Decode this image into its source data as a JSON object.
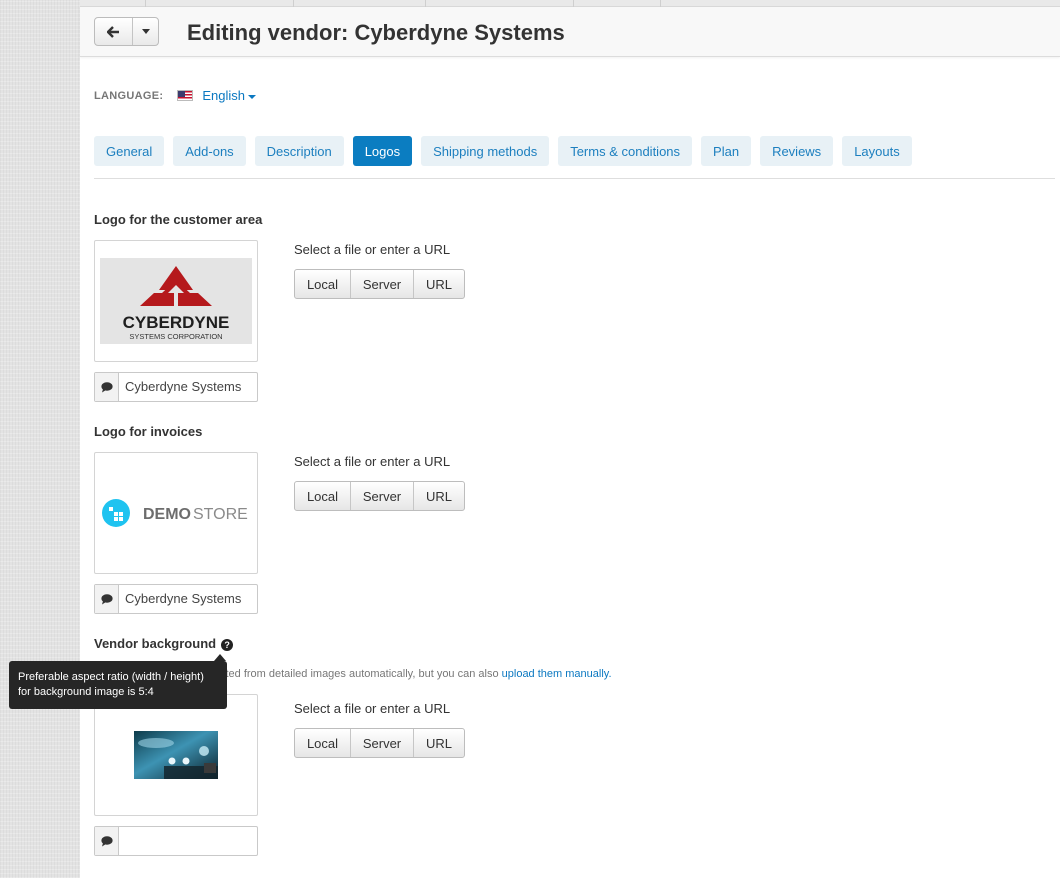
{
  "header": {
    "title": "Editing vendor: Cyberdyne Systems"
  },
  "language": {
    "label": "LANGUAGE:",
    "value": "English"
  },
  "tabs": [
    {
      "label": "General",
      "active": false
    },
    {
      "label": "Add-ons",
      "active": false
    },
    {
      "label": "Description",
      "active": false
    },
    {
      "label": "Logos",
      "active": true
    },
    {
      "label": "Shipping methods",
      "active": false
    },
    {
      "label": "Terms & conditions",
      "active": false
    },
    {
      "label": "Plan",
      "active": false
    },
    {
      "label": "Reviews",
      "active": false
    },
    {
      "label": "Layouts",
      "active": false
    }
  ],
  "sections": {
    "customer_logo": {
      "title": "Logo for the customer area",
      "select_label": "Select a file or enter a URL",
      "logo_text": "CYBERDYNE",
      "logo_subtext": "SYSTEMS CORPORATION",
      "alt_text": "Cyberdyne Systems"
    },
    "invoice_logo": {
      "title": "Logo for invoices",
      "select_label": "Select a file or enter a URL",
      "logo_text_bold": "DEMO",
      "logo_text_light": "STORE",
      "alt_text": "Cyberdyne Systems"
    },
    "background": {
      "title": "Vendor background",
      "hint_prefix": "The thumbnails are generated from detailed images automatically, but you can also",
      "hint_link": "upload them manually.",
      "select_label": "Select a file or enter a URL",
      "alt_text": ""
    }
  },
  "file_buttons": {
    "local": "Local",
    "server": "Server",
    "url": "URL"
  },
  "tooltip": {
    "line1": "Preferable aspect ratio (width / height)",
    "line2": "for background image is 5:4"
  },
  "colors": {
    "accent": "#0b7dc1",
    "tab_bg": "#e8f1f6",
    "cyberdyne_red": "#b5191c",
    "demo_store_cyan": "#1fc3f0"
  }
}
